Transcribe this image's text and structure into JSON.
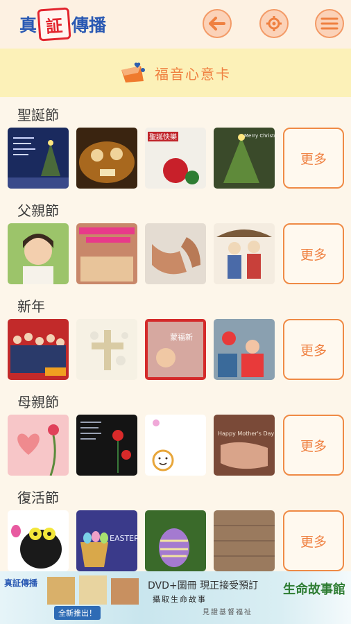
{
  "header": {
    "logo_part1": "真",
    "logo_seal": "証",
    "logo_part2": "傳播",
    "back_icon": "back-arrow-icon",
    "settings_icon": "gear-icon",
    "menu_icon": "hamburger-menu-icon",
    "accent_color": "#ef8040"
  },
  "banner": {
    "title": "福音心意卡",
    "icon": "gift-card-icon"
  },
  "sections": [
    {
      "title": "聖誕節",
      "more_label": "更多",
      "thumb_texts": [
        "",
        "",
        "聖誕快樂",
        "Merry Christmas"
      ]
    },
    {
      "title": "父親節",
      "more_label": "更多",
      "thumb_texts": [
        "",
        "",
        "",
        ""
      ]
    },
    {
      "title": "新年",
      "more_label": "更多",
      "thumb_texts": [
        "",
        "",
        "蒙福新",
        ""
      ]
    },
    {
      "title": "母親節",
      "more_label": "更多",
      "thumb_texts": [
        "",
        "",
        "",
        "Happy Mother's Day"
      ]
    },
    {
      "title": "復活節",
      "more_label": "更多",
      "thumb_texts": [
        "",
        "EASTER",
        "",
        ""
      ]
    }
  ],
  "ad": {
    "logo": "真証傳播",
    "headline": "DVD+圖冊 現正接受預訂",
    "sub1": "攝取生命故事",
    "sub2": "見證基督福祉",
    "launch": "全新推出！",
    "hall": "生命故事館"
  }
}
